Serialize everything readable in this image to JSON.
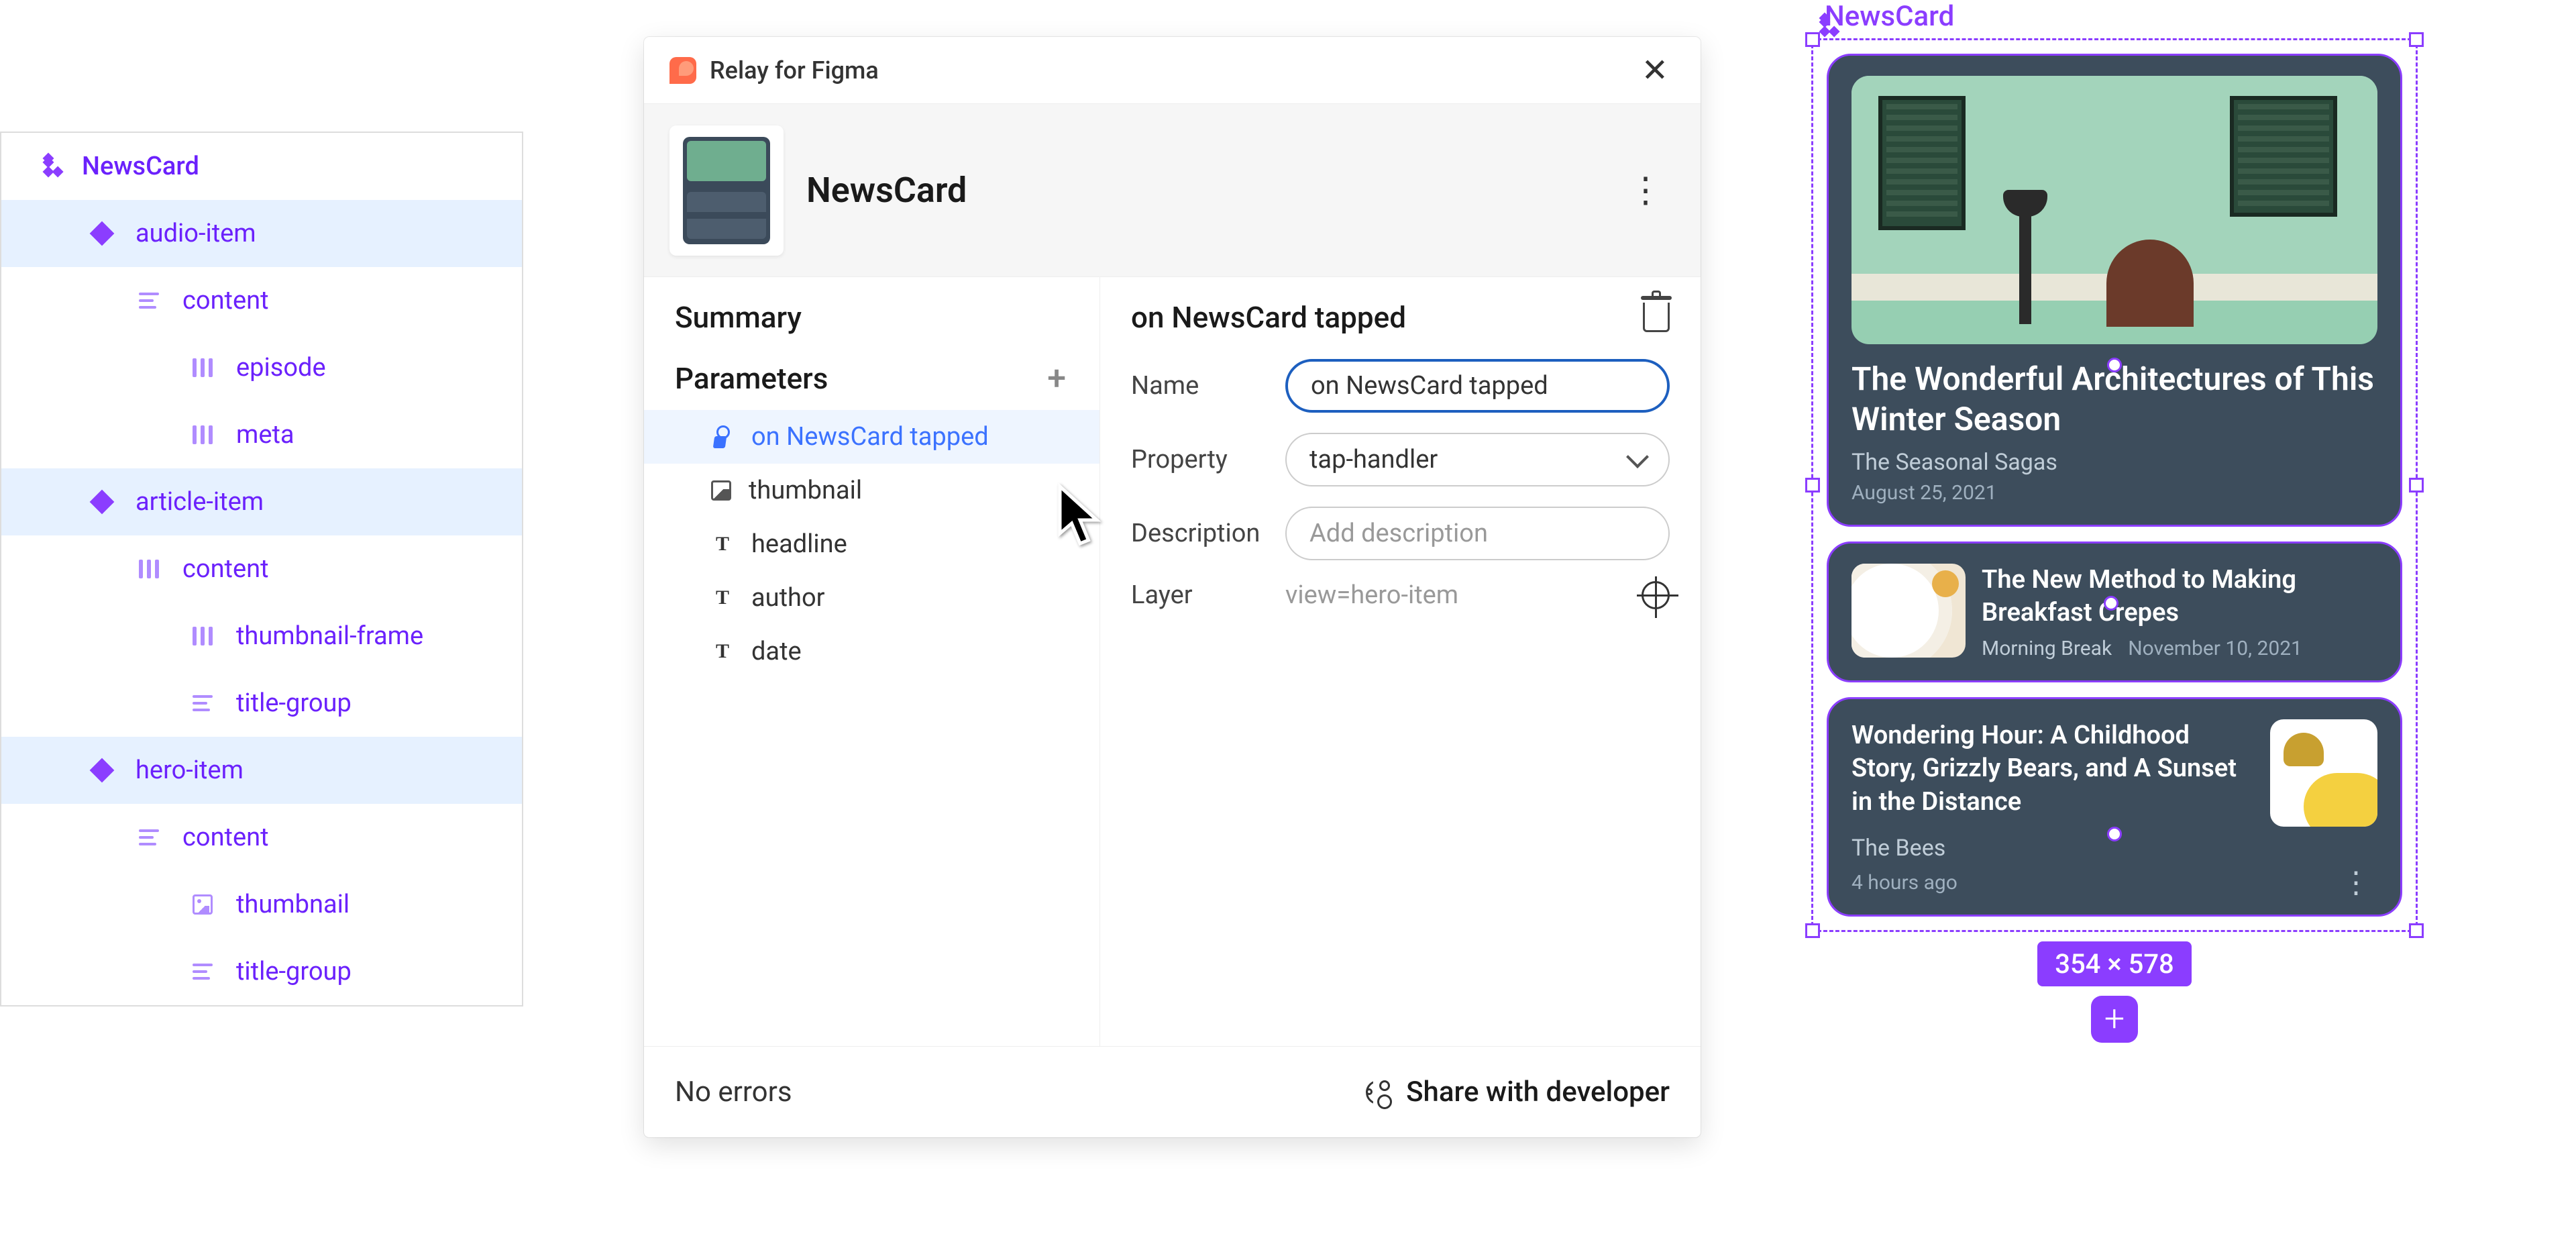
{
  "layers": {
    "component": "NewsCard",
    "rows": [
      {
        "icon": "diamond",
        "label": "audio-item",
        "depth": 1,
        "sel": true
      },
      {
        "icon": "bars",
        "label": "content",
        "depth": 2,
        "sel": false
      },
      {
        "icon": "cols",
        "label": "episode",
        "depth": 3,
        "sel": false
      },
      {
        "icon": "cols",
        "label": "meta",
        "depth": 3,
        "sel": false
      },
      {
        "icon": "diamond",
        "label": "article-item",
        "depth": 1,
        "sel": true
      },
      {
        "icon": "cols",
        "label": "content",
        "depth": 2,
        "sel": false
      },
      {
        "icon": "cols",
        "label": "thumbnail-frame",
        "depth": 3,
        "sel": false
      },
      {
        "icon": "bars",
        "label": "title-group",
        "depth": 3,
        "sel": false
      },
      {
        "icon": "diamond",
        "label": "hero-item",
        "depth": 1,
        "sel": true
      },
      {
        "icon": "bars",
        "label": "content",
        "depth": 2,
        "sel": false
      },
      {
        "icon": "img",
        "label": "thumbnail",
        "depth": 3,
        "sel": false
      },
      {
        "icon": "bars",
        "label": "title-group",
        "depth": 3,
        "sel": false
      }
    ]
  },
  "relay": {
    "plugin_title": "Relay for Figma",
    "component_name": "NewsCard",
    "summary_label": "Summary",
    "parameters_label": "Parameters",
    "params": [
      {
        "icon": "tap",
        "label": "on NewsCard tapped",
        "active": true
      },
      {
        "icon": "img",
        "label": "thumbnail",
        "active": false
      },
      {
        "icon": "text",
        "label": "headline",
        "active": false
      },
      {
        "icon": "text",
        "label": "author",
        "active": false
      },
      {
        "icon": "text",
        "label": "date",
        "active": false
      }
    ],
    "detail": {
      "title": "on NewsCard tapped",
      "name_label": "Name",
      "name_value": "on NewsCard tapped",
      "property_label": "Property",
      "property_value": "tap-handler",
      "description_label": "Description",
      "description_placeholder": "Add description",
      "layer_label": "Layer",
      "layer_value": "view=hero-item"
    },
    "footer": {
      "status": "No errors",
      "share": "Share with developer"
    }
  },
  "canvas": {
    "component_label": "NewsCard",
    "dimensions": "354 × 578",
    "hero": {
      "headline": "The Wonderful Architectures of This Winter Season",
      "source": "The Seasonal Sagas",
      "date": "August 25, 2021"
    },
    "article": {
      "headline": "The New Method to Making Breakfast Crepes",
      "source": "Morning Break",
      "date": "November 10, 2021"
    },
    "audio": {
      "headline": "Wondering Hour: A Childhood Story, Grizzly Bears, and A Sunset in the Distance",
      "source": "The Bees",
      "date": "4 hours ago"
    }
  }
}
